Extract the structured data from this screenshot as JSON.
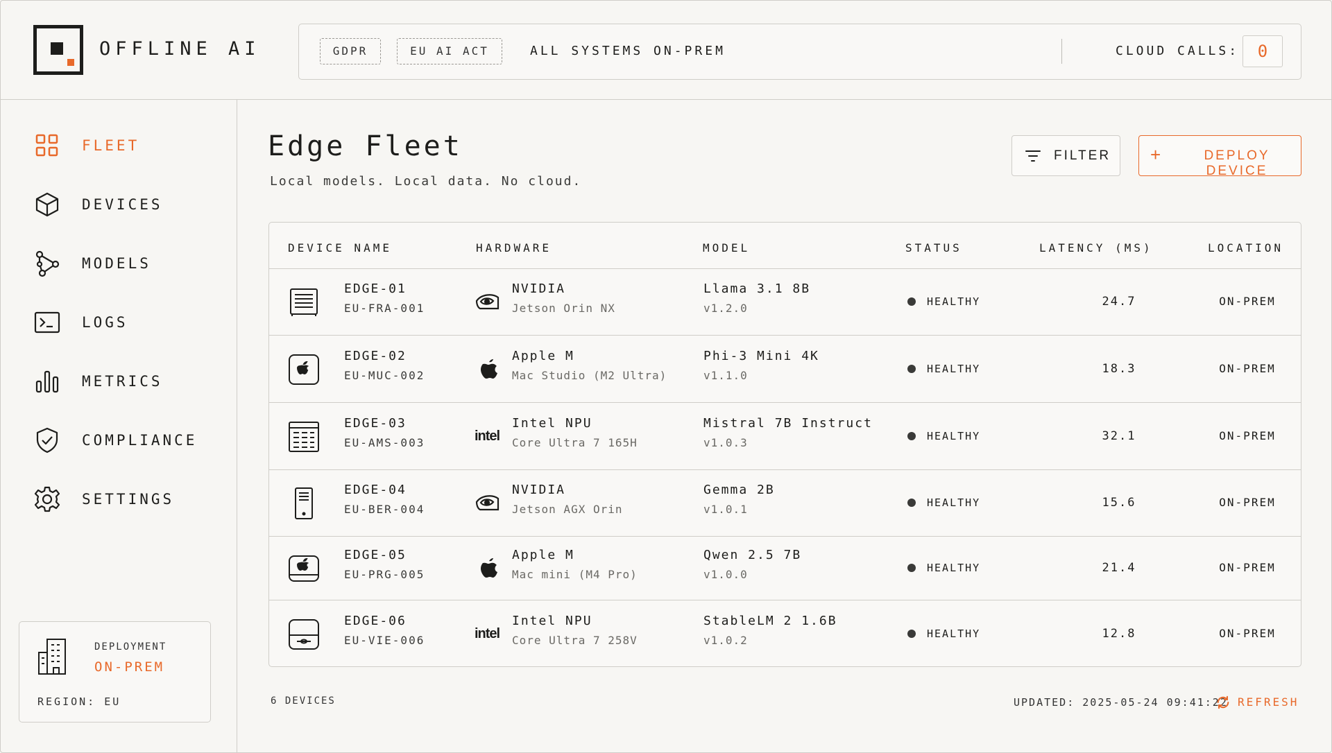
{
  "colors": {
    "accent": "#e8692a",
    "text": "#1d1d1b",
    "border": "#cfcdc8",
    "background": "#f7f6f3"
  },
  "header": {
    "brand": "OFFLINE AI",
    "tags": [
      "GDPR",
      "EU AI ACT"
    ],
    "system_status": "ALL SYSTEMS ON-PREM",
    "cloud_calls_label": "CLOUD CALLS:",
    "cloud_calls_value": "0"
  },
  "sidebar": {
    "items": [
      {
        "label": "FLEET",
        "icon": "grid-icon",
        "active": true
      },
      {
        "label": "DEVICES",
        "icon": "cube-icon",
        "active": false
      },
      {
        "label": "MODELS",
        "icon": "graph-icon",
        "active": false
      },
      {
        "label": "LOGS",
        "icon": "terminal-icon",
        "active": false
      },
      {
        "label": "METRICS",
        "icon": "bar-chart-icon",
        "active": false
      },
      {
        "label": "COMPLIANCE",
        "icon": "shield-check-icon",
        "active": false
      },
      {
        "label": "SETTINGS",
        "icon": "gear-icon",
        "active": false
      }
    ],
    "deployment": {
      "label": "DEPLOYMENT",
      "value": "ON-PREM",
      "region": "REGION: EU"
    }
  },
  "main": {
    "title": "Edge Fleet",
    "subtitle": "Local models. Local data. No cloud.",
    "filter_label": "FILTER",
    "deploy_label": "DEPLOY DEVICE"
  },
  "table": {
    "columns": [
      "DEVICE NAME",
      "HARDWARE",
      "MODEL",
      "STATUS",
      "LATENCY (MS)",
      "LOCATION"
    ],
    "rows": [
      {
        "name": "EDGE-01",
        "id": "EU-FRA-001",
        "hw_vendor": "NVIDIA",
        "hw_model": "Jetson Orin NX",
        "hw_icon": "nvidia-icon",
        "model": "Llama 3.1 8B",
        "version": "v1.2.0",
        "status": "HEALTHY",
        "latency": "24.7",
        "location": "ON-PREM",
        "device_icon": "server-icon"
      },
      {
        "name": "EDGE-02",
        "id": "EU-MUC-002",
        "hw_vendor": "Apple M",
        "hw_model": "Mac Studio (M2 Ultra)",
        "hw_icon": "apple-icon",
        "model": "Phi-3 Mini 4K",
        "version": "v1.1.0",
        "status": "HEALTHY",
        "latency": "18.3",
        "location": "ON-PREM",
        "device_icon": "mac-studio-icon"
      },
      {
        "name": "EDGE-03",
        "id": "EU-AMS-003",
        "hw_vendor": "Intel NPU",
        "hw_model": "Core Ultra 7 165H",
        "hw_icon": "intel-icon",
        "model": "Mistral 7B Instruct",
        "version": "v1.0.3",
        "status": "HEALTHY",
        "latency": "32.1",
        "location": "ON-PREM",
        "device_icon": "panel-icon"
      },
      {
        "name": "EDGE-04",
        "id": "EU-BER-004",
        "hw_vendor": "NVIDIA",
        "hw_model": "Jetson AGX Orin",
        "hw_icon": "nvidia-icon",
        "model": "Gemma 2B",
        "version": "v1.0.1",
        "status": "HEALTHY",
        "latency": "15.6",
        "location": "ON-PREM",
        "device_icon": "tower-icon"
      },
      {
        "name": "EDGE-05",
        "id": "EU-PRG-005",
        "hw_vendor": "Apple M",
        "hw_model": "Mac mini (M4 Pro)",
        "hw_icon": "apple-icon",
        "model": "Qwen 2.5 7B",
        "version": "v1.0.0",
        "status": "HEALTHY",
        "latency": "21.4",
        "location": "ON-PREM",
        "device_icon": "mac-mini-icon"
      },
      {
        "name": "EDGE-06",
        "id": "EU-VIE-006",
        "hw_vendor": "Intel NPU",
        "hw_model": "Core Ultra 7 258V",
        "hw_icon": "intel-icon",
        "model": "StableLM 2 1.6B",
        "version": "v1.0.2",
        "status": "HEALTHY",
        "latency": "12.8",
        "location": "ON-PREM",
        "device_icon": "nuc-icon"
      }
    ]
  },
  "footer": {
    "count": "6 DEVICES",
    "updated": "UPDATED: 2025-05-24 09:41:22",
    "refresh_label": "REFRESH"
  }
}
